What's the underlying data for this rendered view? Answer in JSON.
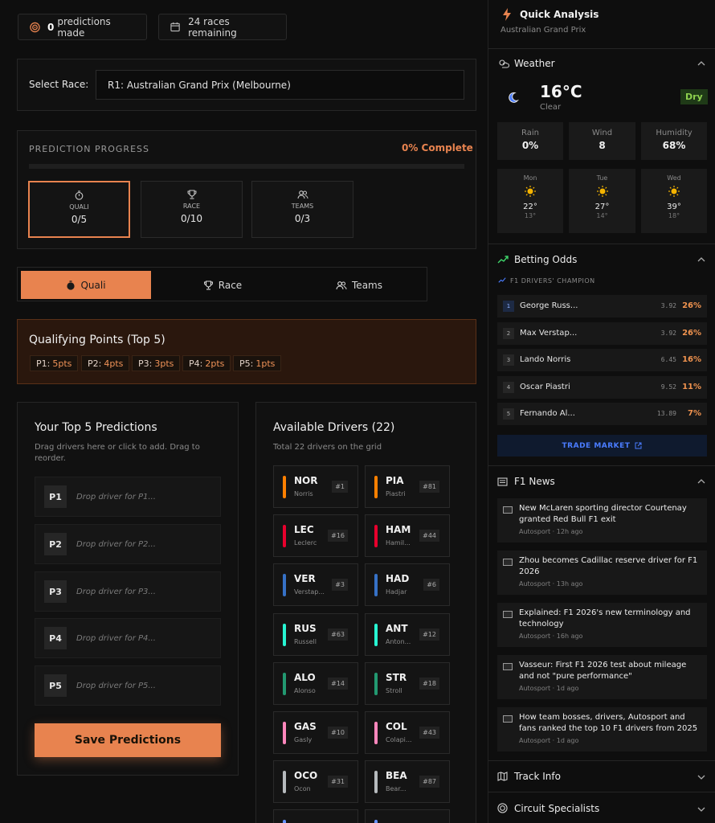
{
  "stats": {
    "predictions_count": "0",
    "predictions_label": "predictions made",
    "races_remaining": "24 races remaining"
  },
  "race_select": {
    "label": "Select Race:",
    "value": "R1: Australian Grand Prix (Melbourne)"
  },
  "progress": {
    "title": "PREDICTION PROGRESS",
    "percent_text": "0% Complete",
    "percent": 0,
    "stages": [
      {
        "label": "QUALI",
        "value": "0/5",
        "icon": "stopwatch-icon"
      },
      {
        "label": "RACE",
        "value": "0/10",
        "icon": "trophy-icon"
      },
      {
        "label": "TEAMS",
        "value": "0/3",
        "icon": "users-icon"
      }
    ]
  },
  "tabs": [
    {
      "label": "Quali",
      "icon": "stopwatch-icon",
      "active": true
    },
    {
      "label": "Race",
      "icon": "trophy-icon",
      "active": false
    },
    {
      "label": "Teams",
      "icon": "users-icon",
      "active": false
    }
  ],
  "points": {
    "title": "Qualifying Points (Top 5)",
    "chips": [
      {
        "pos": "P1:",
        "pts": "5pts"
      },
      {
        "pos": "P2:",
        "pts": "4pts"
      },
      {
        "pos": "P3:",
        "pts": "3pts"
      },
      {
        "pos": "P4:",
        "pts": "2pts"
      },
      {
        "pos": "P5:",
        "pts": "1pts"
      }
    ]
  },
  "predictions": {
    "title": "Your Top 5 Predictions",
    "subtitle": "Drag drivers here or click to add. Drag to reorder.",
    "slots": [
      {
        "pos": "P1",
        "placeholder": "Drop driver for P1..."
      },
      {
        "pos": "P2",
        "placeholder": "Drop driver for P2..."
      },
      {
        "pos": "P3",
        "placeholder": "Drop driver for P3..."
      },
      {
        "pos": "P4",
        "placeholder": "Drop driver for P4..."
      },
      {
        "pos": "P5",
        "placeholder": "Drop driver for P5..."
      }
    ],
    "save_label": "Save Predictions"
  },
  "drivers": {
    "title": "Available Drivers (22)",
    "subtitle": "Total 22 drivers on the grid",
    "list": [
      {
        "code": "NOR",
        "name": "Norris",
        "number": "#1",
        "color": "#ff8000"
      },
      {
        "code": "PIA",
        "name": "Piastri",
        "number": "#81",
        "color": "#ff8000"
      },
      {
        "code": "LEC",
        "name": "Leclerc",
        "number": "#16",
        "color": "#e8002d"
      },
      {
        "code": "HAM",
        "name": "Hamil...",
        "number": "#44",
        "color": "#e8002d"
      },
      {
        "code": "VER",
        "name": "Verstap...",
        "number": "#3",
        "color": "#3671c6"
      },
      {
        "code": "HAD",
        "name": "Hadjar",
        "number": "#6",
        "color": "#3671c6"
      },
      {
        "code": "RUS",
        "name": "Russell",
        "number": "#63",
        "color": "#27f4d2"
      },
      {
        "code": "ANT",
        "name": "Anton...",
        "number": "#12",
        "color": "#27f4d2"
      },
      {
        "code": "ALO",
        "name": "Alonso",
        "number": "#14",
        "color": "#229971"
      },
      {
        "code": "STR",
        "name": "Stroll",
        "number": "#18",
        "color": "#229971"
      },
      {
        "code": "GAS",
        "name": "Gasly",
        "number": "#10",
        "color": "#ff87bc"
      },
      {
        "code": "COL",
        "name": "Colapi...",
        "number": "#43",
        "color": "#ff87bc"
      },
      {
        "code": "OCO",
        "name": "Ocon",
        "number": "#31",
        "color": "#b6babd"
      },
      {
        "code": "BEA",
        "name": "Bear...",
        "number": "#87",
        "color": "#b6babd"
      }
    ]
  },
  "quick_analysis": {
    "title": "Quick Analysis",
    "subtitle": "Australian Grand Prix"
  },
  "weather": {
    "title": "Weather",
    "temp": "16°C",
    "condition": "Clear",
    "badge": "Dry",
    "stats": [
      {
        "label": "Rain",
        "value": "0%"
      },
      {
        "label": "Wind",
        "value": "8"
      },
      {
        "label": "Humidity",
        "value": "68%"
      }
    ],
    "forecast": [
      {
        "day": "Mon",
        "high": "22°",
        "low": "13°"
      },
      {
        "day": "Tue",
        "high": "27°",
        "low": "14°"
      },
      {
        "day": "Wed",
        "high": "39°",
        "low": "18°"
      }
    ]
  },
  "odds": {
    "title": "Betting Odds",
    "subtitle": "F1 DRIVERS' CHAMPION",
    "rows": [
      {
        "rank": "1",
        "name": "George Russ...",
        "odds": "3.92",
        "pct": "26%"
      },
      {
        "rank": "2",
        "name": "Max Verstap...",
        "odds": "3.92",
        "pct": "26%"
      },
      {
        "rank": "3",
        "name": "Lando Norris",
        "odds": "6.45",
        "pct": "16%"
      },
      {
        "rank": "4",
        "name": "Oscar Piastri",
        "odds": "9.52",
        "pct": "11%"
      },
      {
        "rank": "5",
        "name": "Fernando Al...",
        "odds": "13.89",
        "pct": "7%"
      }
    ],
    "trade_label": "TRADE MARKET"
  },
  "news": {
    "title": "F1 News",
    "items": [
      {
        "headline": "New McLaren sporting director Courtenay granted Red Bull F1 exit",
        "meta": "Autosport · 12h ago"
      },
      {
        "headline": "Zhou becomes Cadillac reserve driver for F1 2026",
        "meta": "Autosport · 13h ago"
      },
      {
        "headline": "Explained: F1 2026's new terminology and technology",
        "meta": "Autosport · 16h ago"
      },
      {
        "headline": "Vasseur: First F1 2026 test about mileage and not \"pure performance\"",
        "meta": "Autosport · 1d ago"
      },
      {
        "headline": "How team bosses, drivers, Autosport and fans ranked the top 10 F1 drivers from 2025",
        "meta": "Autosport · 1d ago"
      }
    ]
  },
  "track_info": {
    "title": "Track Info"
  },
  "circuit_specialists": {
    "title": "Circuit Specialists"
  },
  "colors": {
    "accent": "#e8834f",
    "background": "#0e0e0e",
    "dry_badge": "#8fd14f"
  }
}
